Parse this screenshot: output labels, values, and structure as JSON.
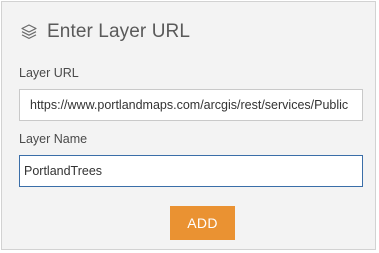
{
  "panel": {
    "title": "Enter Layer URL",
    "title_icon": "layers-icon"
  },
  "form": {
    "url_label": "Layer URL",
    "url_value": "https://www.portlandmaps.com/arcgis/rest/services/Public",
    "name_label": "Layer Name",
    "name_value": "PortlandTrees"
  },
  "actions": {
    "add_label": "ADD"
  },
  "colors": {
    "accent": "#ea9232",
    "focus_border": "#3a6ea8",
    "panel_bg": "#f3f3f3"
  }
}
